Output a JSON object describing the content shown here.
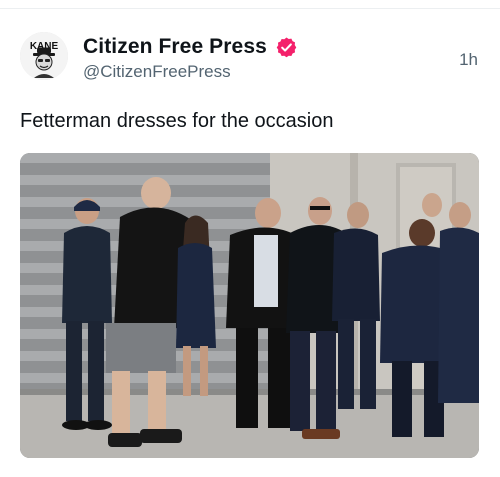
{
  "tweet": {
    "author": {
      "display_name": "Citizen Free Press",
      "handle": "@CitizenFreePress",
      "verified": true,
      "verified_color": "#f4216b",
      "avatar_text": "KANE"
    },
    "timestamp": "1h",
    "text": "Fetterman dresses for the occasion",
    "media": {
      "type": "photo",
      "icon": "photo"
    }
  },
  "colors": {
    "text": "#0f1419",
    "secondary": "#536471",
    "badge": "#f4216b"
  }
}
